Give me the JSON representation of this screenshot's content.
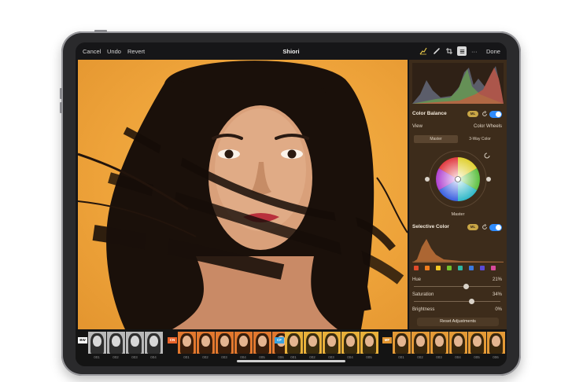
{
  "toolbar": {
    "cancel_label": "Cancel",
    "undo_label": "Undo",
    "revert_label": "Revert",
    "title": "Shiori",
    "more_label": "···",
    "done_label": "Done"
  },
  "panel": {
    "color_balance": {
      "title": "Color Balance",
      "ml_badge": "ML",
      "view_label": "View",
      "view_value": "Color Wheels",
      "segments": [
        "Master",
        "3-Way Color"
      ],
      "wheel_label": "Master",
      "enabled": true
    },
    "selective_color": {
      "title": "Selective Color",
      "ml_badge": "ML",
      "enabled": true,
      "swatch_colors": [
        "#e04a2a",
        "#f07d1e",
        "#f2c624",
        "#73c12e",
        "#2fb6a4",
        "#3a79e0",
        "#5a4ad8",
        "#d94a9c"
      ]
    },
    "sliders": [
      {
        "label": "Hue",
        "value_text": "21%",
        "value": 0.21
      },
      {
        "label": "Saturation",
        "value_text": "34%",
        "value": 0.34
      },
      {
        "label": "Brightness",
        "value_text": "0%",
        "value": 0.0
      }
    ],
    "reset_label": "Reset Adjustments"
  },
  "filmstrip": {
    "groups": [
      {
        "label": "BW",
        "label_color": "#ffffff",
        "label_text_color": "#111111",
        "tint": "#b9b9b9",
        "numbers": [
          "001",
          "002",
          "003",
          "004"
        ]
      },
      {
        "label": "CN",
        "label_color": "#e8632a",
        "label_text_color": "#ffffff",
        "tint": "#e2782e",
        "numbers": [
          "001",
          "002",
          "003",
          "004",
          "005",
          "006"
        ]
      },
      {
        "label": "CF",
        "label_color": "#3aa3e0",
        "label_text_color": "#ffffff",
        "tint": "#e8b03a",
        "numbers": [
          "001",
          "002",
          "003",
          "004",
          "005"
        ]
      },
      {
        "label": "MF",
        "label_color": "#e2952f",
        "label_text_color": "#ffffff",
        "tint": "#e49a36",
        "numbers": [
          "001",
          "002",
          "003",
          "004",
          "005",
          "006"
        ]
      }
    ]
  },
  "colors": {
    "accent": "#2f8cff",
    "panel_bg": "#3d2c1b",
    "photo_bg": "#eea33a"
  }
}
